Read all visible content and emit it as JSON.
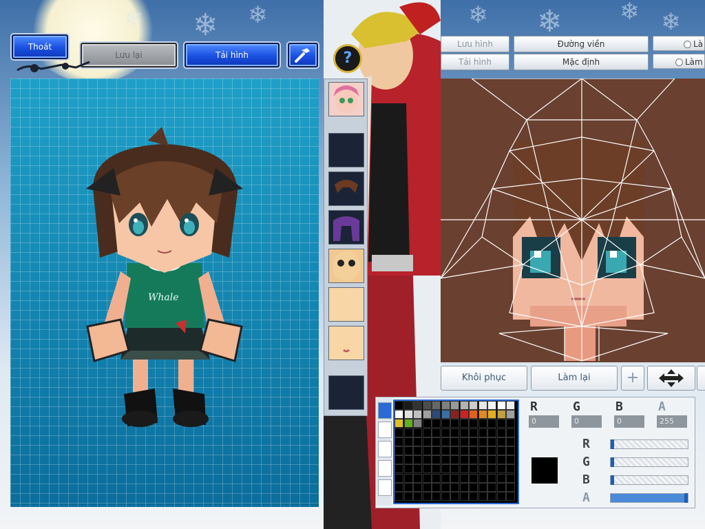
{
  "top_buttons": {
    "exit": "Thoát",
    "save": "Lưu lại",
    "reload": "Tải hình"
  },
  "toolbar": {
    "save_image": "Lưu hình",
    "load_image": "Tải hình",
    "outline": "Đường viền",
    "default": "Mặc định",
    "radio_1": "Là",
    "radio_2": "Làm"
  },
  "bottom_controls": {
    "restore": "Khôi phục",
    "redo": "Làm lại"
  },
  "color_panel": {
    "channels": [
      "R",
      "G",
      "B",
      "A"
    ],
    "values": [
      "0",
      "0",
      "0",
      "255"
    ],
    "current_color": "#000000",
    "slider_levels": [
      0,
      0,
      0,
      1.0
    ]
  },
  "palette_colors": [
    "#000000",
    "#1a1a1a",
    "#333333",
    "#4d4d4d",
    "#666666",
    "#808080",
    "#999999",
    "#b3b3b3",
    "#cccccc",
    "#e6e6e6",
    "#f2f2f2",
    "#ffffff",
    "#f0f0f0",
    "#ffffff",
    "#e0e0e0",
    "#c0c0c0",
    "#a0a0a0",
    "#2c4a7a",
    "#3a6ea5",
    "#8b2020",
    "#d02020",
    "#e06020",
    "#e08a20",
    "#e0b020",
    "#c0a040",
    "#a0a0a0",
    "#e0c020",
    "#60b020",
    "#808080"
  ],
  "thumbnails": [
    "face-portrait",
    "empty",
    "hair-brown",
    "hair-purple",
    "face-eyes",
    "face-plain",
    "face-mouth",
    "empty"
  ]
}
